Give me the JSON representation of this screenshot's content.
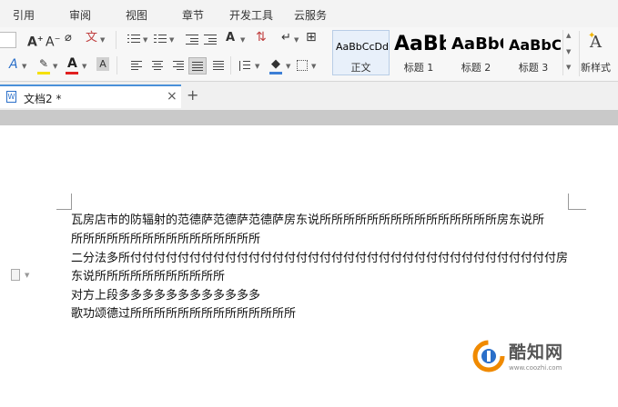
{
  "menu": {
    "items": [
      "引用",
      "审阅",
      "视图",
      "章节",
      "开发工具",
      "云服务"
    ]
  },
  "styles": {
    "items": [
      {
        "preview": "AaBbCcDd",
        "name": "正文",
        "selected": true
      },
      {
        "preview": "AaBb",
        "name": "标题 1"
      },
      {
        "preview": "AaBbC",
        "name": "标题 2"
      },
      {
        "preview": "AaBbC",
        "name": "标题 3"
      }
    ],
    "new_style_label": "新样式"
  },
  "document_tab": {
    "title": "文档2 *",
    "close_symbol": "×",
    "add_symbol": "+"
  },
  "document": {
    "lines": [
      "瓦房店市的防辐射的范德萨范德萨范德萨房东说所所所所所所所所所所所所所所所房东说所",
      "所所所所所所所所所所所所所所所所",
      "二分法多所付付付付付付付付付付付付付付付付付付付付付付付付付付付付付付付付付付付付房",
      "东说所所所所所所所所所所所",
      "对方上段多多多多多多多多多多多多",
      "歌功颂德过所所所所所所所所所所所所所所"
    ]
  },
  "watermark": {
    "brand": "酷知网",
    "url": "www.coozhi.com"
  },
  "colors": {
    "accent": "#4a90d9",
    "highlight_yellow": "#f5e000",
    "font_color_red": "#e02020",
    "shading_blue": "#3d7fd6",
    "watermark_orange": "#f08a00"
  }
}
